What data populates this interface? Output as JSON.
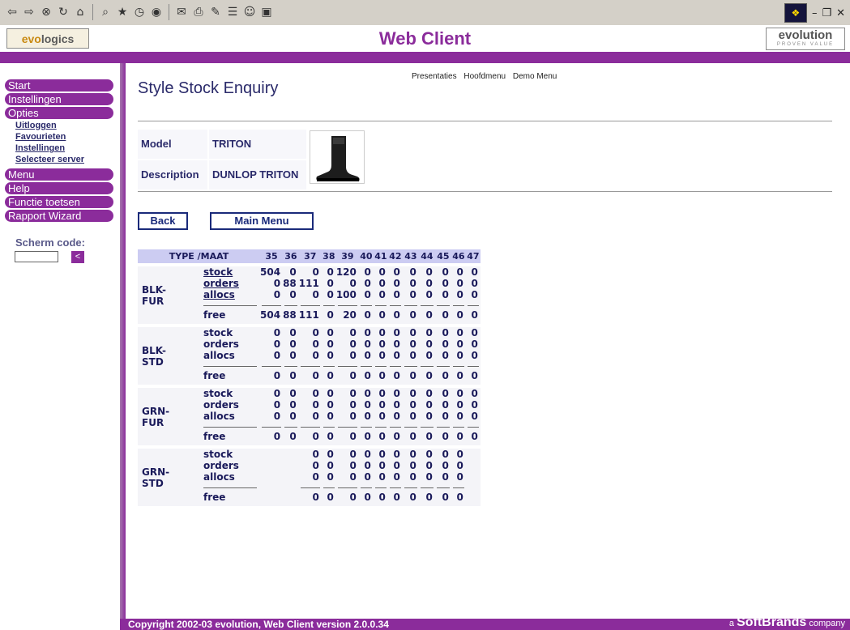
{
  "browser": {
    "toolbar_icons": [
      "back-icon",
      "forward-icon",
      "stop-icon",
      "refresh-icon",
      "home-icon",
      "search-icon",
      "favorites-icon",
      "history-icon",
      "media-icon",
      "mail-icon",
      "print-icon",
      "edit-icon",
      "discuss-icon",
      "messenger-icon",
      "fullscreen-icon"
    ]
  },
  "header": {
    "logo_left_evo": "evo",
    "logo_left_rest": "logics",
    "title": "Web Client",
    "logo_right": "evolution",
    "logo_right_tagline": "PROVEN VALUE"
  },
  "sidebar": {
    "menu": [
      "Start",
      "Instellingen",
      "Opties",
      "Menu",
      "Help",
      "Functie toetsen",
      "Rapport Wizard"
    ],
    "submenu": [
      "Uitloggen",
      "Favourieten",
      "Instellingen",
      "Selecteer server"
    ],
    "scherm_label": "Scherm code:",
    "scherm_btn": "<"
  },
  "top_links": [
    "Presentaties",
    "Hoofdmenu",
    "Demo Menu"
  ],
  "page": {
    "title": "Style Stock Enquiry",
    "model_label": "Model",
    "model_value": "TRITON",
    "description_label": "Description",
    "description_value": "DUNLOP TRITON"
  },
  "buttons": {
    "back": "Back",
    "main_menu": "Main Menu"
  },
  "table": {
    "header_type": "TYPE /MAAT",
    "sizes": [
      "35",
      "36",
      "37",
      "38",
      "39",
      "40",
      "41",
      "42",
      "43",
      "44",
      "45",
      "46",
      "47"
    ],
    "groups": [
      {
        "type": "BLK-FUR",
        "rows": [
          {
            "label": "stock",
            "link": true,
            "values": [
              "504",
              "0",
              "0",
              "0",
              "120",
              "0",
              "0",
              "0",
              "0",
              "0",
              "0",
              "0",
              "0"
            ]
          },
          {
            "label": "orders",
            "link": true,
            "values": [
              "0",
              "88",
              "111",
              "0",
              "0",
              "0",
              "0",
              "0",
              "0",
              "0",
              "0",
              "0",
              "0"
            ]
          },
          {
            "label": "allocs",
            "link": true,
            "values": [
              "0",
              "0",
              "0",
              "0",
              "100",
              "0",
              "0",
              "0",
              "0",
              "0",
              "0",
              "0",
              "0"
            ]
          }
        ],
        "free": [
          "504",
          "88",
          "111",
          "0",
          "20",
          "0",
          "0",
          "0",
          "0",
          "0",
          "0",
          "0",
          "0"
        ]
      },
      {
        "type": "BLK-STD",
        "rows": [
          {
            "label": "stock",
            "link": false,
            "values": [
              "0",
              "0",
              "0",
              "0",
              "0",
              "0",
              "0",
              "0",
              "0",
              "0",
              "0",
              "0",
              "0"
            ]
          },
          {
            "label": "orders",
            "link": false,
            "values": [
              "0",
              "0",
              "0",
              "0",
              "0",
              "0",
              "0",
              "0",
              "0",
              "0",
              "0",
              "0",
              "0"
            ]
          },
          {
            "label": "allocs",
            "link": false,
            "values": [
              "0",
              "0",
              "0",
              "0",
              "0",
              "0",
              "0",
              "0",
              "0",
              "0",
              "0",
              "0",
              "0"
            ]
          }
        ],
        "free": [
          "0",
          "0",
          "0",
          "0",
          "0",
          "0",
          "0",
          "0",
          "0",
          "0",
          "0",
          "0",
          "0"
        ]
      },
      {
        "type": "GRN-FUR",
        "rows": [
          {
            "label": "stock",
            "link": false,
            "values": [
              "0",
              "0",
              "0",
              "0",
              "0",
              "0",
              "0",
              "0",
              "0",
              "0",
              "0",
              "0",
              "0"
            ]
          },
          {
            "label": "orders",
            "link": false,
            "values": [
              "0",
              "0",
              "0",
              "0",
              "0",
              "0",
              "0",
              "0",
              "0",
              "0",
              "0",
              "0",
              "0"
            ]
          },
          {
            "label": "allocs",
            "link": false,
            "values": [
              "0",
              "0",
              "0",
              "0",
              "0",
              "0",
              "0",
              "0",
              "0",
              "0",
              "0",
              "0",
              "0"
            ]
          }
        ],
        "free": [
          "0",
          "0",
          "0",
          "0",
          "0",
          "0",
          "0",
          "0",
          "0",
          "0",
          "0",
          "0",
          "0"
        ]
      },
      {
        "type": "GRN-STD",
        "rows": [
          {
            "label": "stock",
            "link": false,
            "values": [
              "",
              "",
              "0",
              "0",
              "0",
              "0",
              "0",
              "0",
              "0",
              "0",
              "0",
              "0",
              ""
            ]
          },
          {
            "label": "orders",
            "link": false,
            "values": [
              "",
              "",
              "0",
              "0",
              "0",
              "0",
              "0",
              "0",
              "0",
              "0",
              "0",
              "0",
              ""
            ]
          },
          {
            "label": "allocs",
            "link": false,
            "values": [
              "",
              "",
              "0",
              "0",
              "0",
              "0",
              "0",
              "0",
              "0",
              "0",
              "0",
              "0",
              ""
            ]
          }
        ],
        "free": [
          "",
          "",
          "0",
          "0",
          "0",
          "0",
          "0",
          "0",
          "0",
          "0",
          "0",
          "0",
          ""
        ]
      }
    ]
  },
  "footer": {
    "copyright": "Copyright 2002-03 evolution, Web Client version 2.0.0.34",
    "brand_prefix": "a",
    "brand": "SoftBrands",
    "brand_suffix": "company"
  },
  "colors": {
    "accent": "#8b2c9b",
    "text": "#1a1a5a",
    "header_bg": "#ccccf2"
  }
}
